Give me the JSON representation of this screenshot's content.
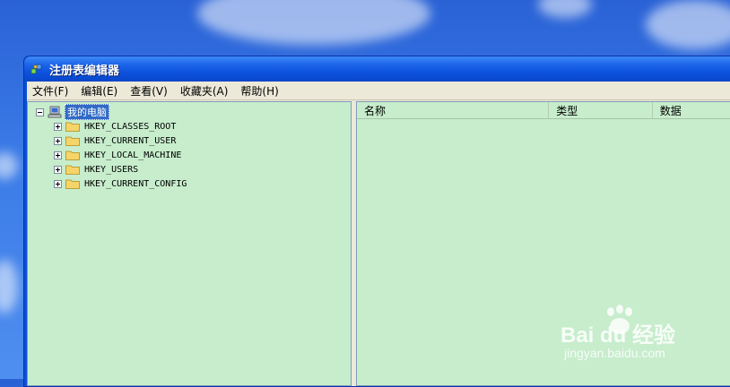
{
  "window": {
    "title": "注册表编辑器"
  },
  "menu": [
    "文件(F)",
    "编辑(E)",
    "查看(V)",
    "收藏夹(A)",
    "帮助(H)"
  ],
  "tree": {
    "root": "我的电脑",
    "keys": [
      "HKEY_CLASSES_ROOT",
      "HKEY_CURRENT_USER",
      "HKEY_LOCAL_MACHINE",
      "HKEY_USERS",
      "HKEY_CURRENT_CONFIG"
    ]
  },
  "list": {
    "columns": [
      "名称",
      "类型",
      "数据"
    ]
  },
  "watermark": {
    "brand": "Bai du 经验",
    "url": "jingyan.baidu.com"
  },
  "colors": {
    "pane_bg": "#c7edcc",
    "title_blue": "#0b4fdb",
    "selection": "#316ac5"
  }
}
